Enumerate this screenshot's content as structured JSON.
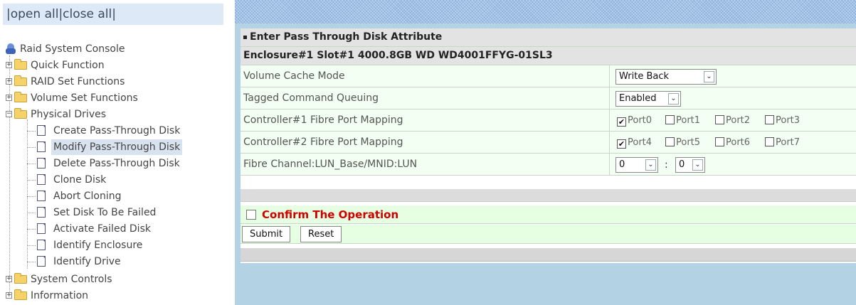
{
  "topbar": {
    "open_all": "open all",
    "close_all": "close all",
    "sep": "|"
  },
  "tree": {
    "root": "Raid System Console",
    "folders": [
      {
        "label": "Quick Function",
        "expanded": false
      },
      {
        "label": "RAID Set Functions",
        "expanded": false
      },
      {
        "label": "Volume Set Functions",
        "expanded": false
      },
      {
        "label": "Physical Drives",
        "expanded": true
      },
      {
        "label": "System Controls",
        "expanded": false
      },
      {
        "label": "Information",
        "expanded": false
      }
    ],
    "physical_drives_items": [
      "Create Pass-Through Disk",
      "Modify Pass-Through Disk",
      "Delete Pass-Through Disk",
      "Clone Disk",
      "Abort Cloning",
      "Set Disk To Be Failed",
      "Activate Failed Disk",
      "Identify Enclosure",
      "Identify Drive"
    ],
    "selected_item": "Modify Pass-Through Disk"
  },
  "form": {
    "title": "Enter Pass Through Disk Attribute",
    "disk_header": "Enclosure#1 Slot#1 4000.8GB WD WD4001FFYG-01SL3",
    "rows": {
      "cache_mode": {
        "label": "Volume Cache Mode",
        "value": "Write Back"
      },
      "tcq": {
        "label": "Tagged Command Queuing",
        "value": "Enabled"
      },
      "ctrl1": {
        "label": "Controller#1 Fibre Port Mapping",
        "ports": [
          {
            "name": "Port0",
            "checked": true
          },
          {
            "name": "Port1",
            "checked": false
          },
          {
            "name": "Port2",
            "checked": false
          },
          {
            "name": "Port3",
            "checked": false
          }
        ]
      },
      "ctrl2": {
        "label": "Controller#2 Fibre Port Mapping",
        "ports": [
          {
            "name": "Port4",
            "checked": true
          },
          {
            "name": "Port5",
            "checked": false
          },
          {
            "name": "Port6",
            "checked": false
          },
          {
            "name": "Port7",
            "checked": false
          }
        ]
      },
      "lun": {
        "label": "Fibre Channel:LUN_Base/MNID:LUN",
        "base": "0",
        "sep": ":",
        "lun": "0"
      }
    },
    "confirm": "Confirm The Operation",
    "submit": "Submit",
    "reset": "Reset"
  },
  "icons": {
    "checkmark": "✔",
    "dropdown": "⌄",
    "plus": "+",
    "minus": "−"
  },
  "colors": {
    "confirm_red": "#d10000",
    "right_bg": "#b3d2e4",
    "selected_bg": "#d9e2ef"
  }
}
